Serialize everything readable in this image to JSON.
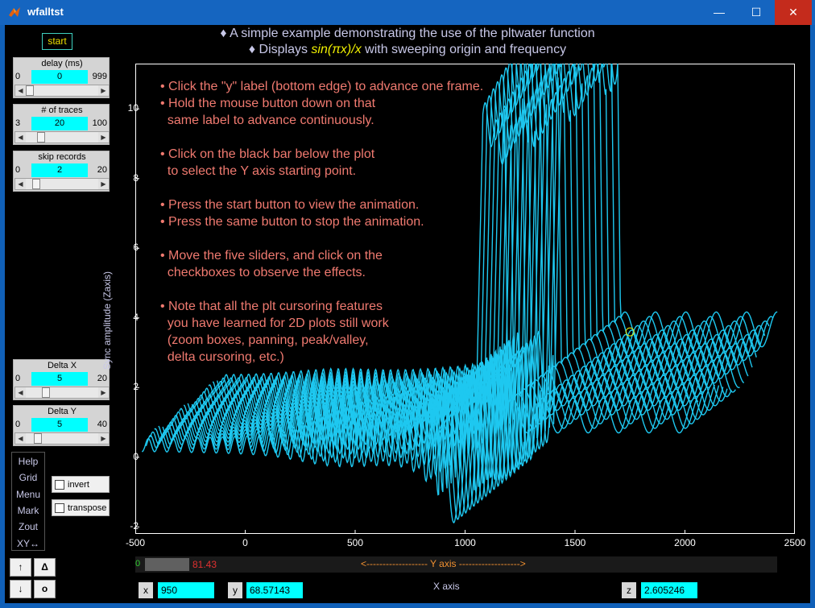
{
  "window": {
    "title": "wfalltst",
    "controls": {
      "minimize": "—",
      "maximize": "☐",
      "close": "✕"
    }
  },
  "header": {
    "line1": "♦ A simple example demonstrating the use of the pltwater function",
    "line2_prefix": "♦ Displays ",
    "line2_formula": "sin(πx)/x",
    "line2_suffix": " with sweeping origin and frequency"
  },
  "start_button": {
    "label": "start"
  },
  "sliders": [
    {
      "label": "delay (ms)",
      "min": "0",
      "max": "999",
      "value": "0",
      "fraction": 0.0
    },
    {
      "label": "# of traces",
      "min": "3",
      "max": "100",
      "value": "20",
      "fraction": 0.18
    },
    {
      "label": "skip records",
      "min": "0",
      "max": "20",
      "value": "2",
      "fraction": 0.1
    },
    {
      "label": "Delta X",
      "min": "0",
      "max": "20",
      "value": "5",
      "fraction": 0.25
    },
    {
      "label": "Delta Y",
      "min": "0",
      "max": "40",
      "value": "5",
      "fraction": 0.125
    }
  ],
  "menu": [
    "Help",
    "Grid",
    "Menu",
    "Mark",
    "Zout",
    "XY↔"
  ],
  "checkboxes": [
    {
      "label": "invert",
      "checked": false
    },
    {
      "label": "transpose",
      "checked": false
    }
  ],
  "arrow_buttons": {
    "up": "↑",
    "down": "↓",
    "delta": "Δ",
    "o": "o"
  },
  "plot": {
    "ylabel": "Sync amplitude (Zaxis)",
    "yticks": [
      "10",
      "8",
      "6",
      "4",
      "2",
      "0",
      "-2"
    ],
    "xticks": [
      "-500",
      "0",
      "500",
      "1000",
      "1500",
      "2000",
      "2500"
    ],
    "trace_color": "#1ec8f0"
  },
  "instructions": [
    "• Click the \"y\" label (bottom edge) to advance one frame.",
    "• Hold the mouse button down on that",
    "  same label to advance continuously.",
    "• Click on the black bar below the plot",
    "  to select the Y axis starting point.",
    "• Press the start button to view the animation.",
    "• Press the same button to stop the animation.",
    "• Move the five sliders, and click on the",
    "  checkboxes to observe the effects.",
    "• Note that all the plt cursoring features",
    "  you have learned for 2D plots still work",
    "  (zoom boxes, panning, peak/valley,",
    "  delta cursoring, etc.)"
  ],
  "ybar": {
    "zero": "0",
    "value": "81.43",
    "text": "<------------------- Y axis ------------------->"
  },
  "xaxis_label": "X axis",
  "readouts": {
    "x_label": "x",
    "x_value": "950",
    "y_label": "y",
    "y_value": "68.57143",
    "z_label": "z",
    "z_value": "2.605246"
  },
  "chart_data": {
    "type": "line",
    "title": "",
    "xlabel": "X axis",
    "ylabel": "Sync amplitude (Zaxis)",
    "xlim": [
      -500,
      2500
    ],
    "ylim": [
      -2.2,
      11.3
    ],
    "num_traces": 20,
    "trace_dx": 19,
    "trace_dy": 0.1,
    "base_x_start": -470,
    "base_x_end": 2060,
    "pulse_peak": 10,
    "series_description": "waterfall of sin(pi x)/x traces with sweeping origin and frequency",
    "cursor": {
      "x": 1750,
      "y": 3.6
    }
  }
}
